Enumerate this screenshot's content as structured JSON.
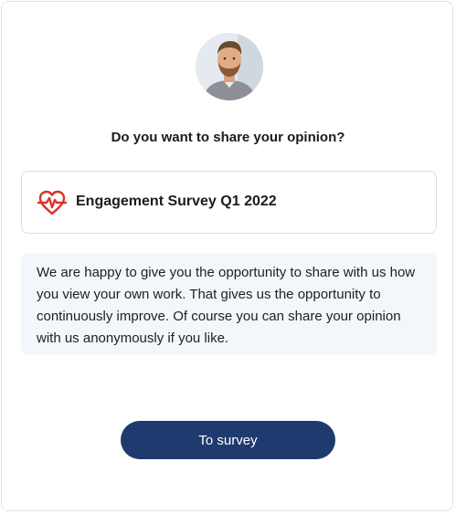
{
  "prompt": {
    "question": "Do you want to share your opinion?"
  },
  "survey": {
    "title": "Engagement Survey Q1 2022",
    "icon": "heartbeat-icon",
    "icon_color": "#d9342b"
  },
  "description": {
    "text": "We are happy to give you the opportunity to share with us how you view your own work. That gives us the opportunity to continuously improve. Of course you can share your opinion with us anonymously if you like."
  },
  "actions": {
    "to_survey_label": "To survey",
    "button_color": "#1f3a6e"
  }
}
